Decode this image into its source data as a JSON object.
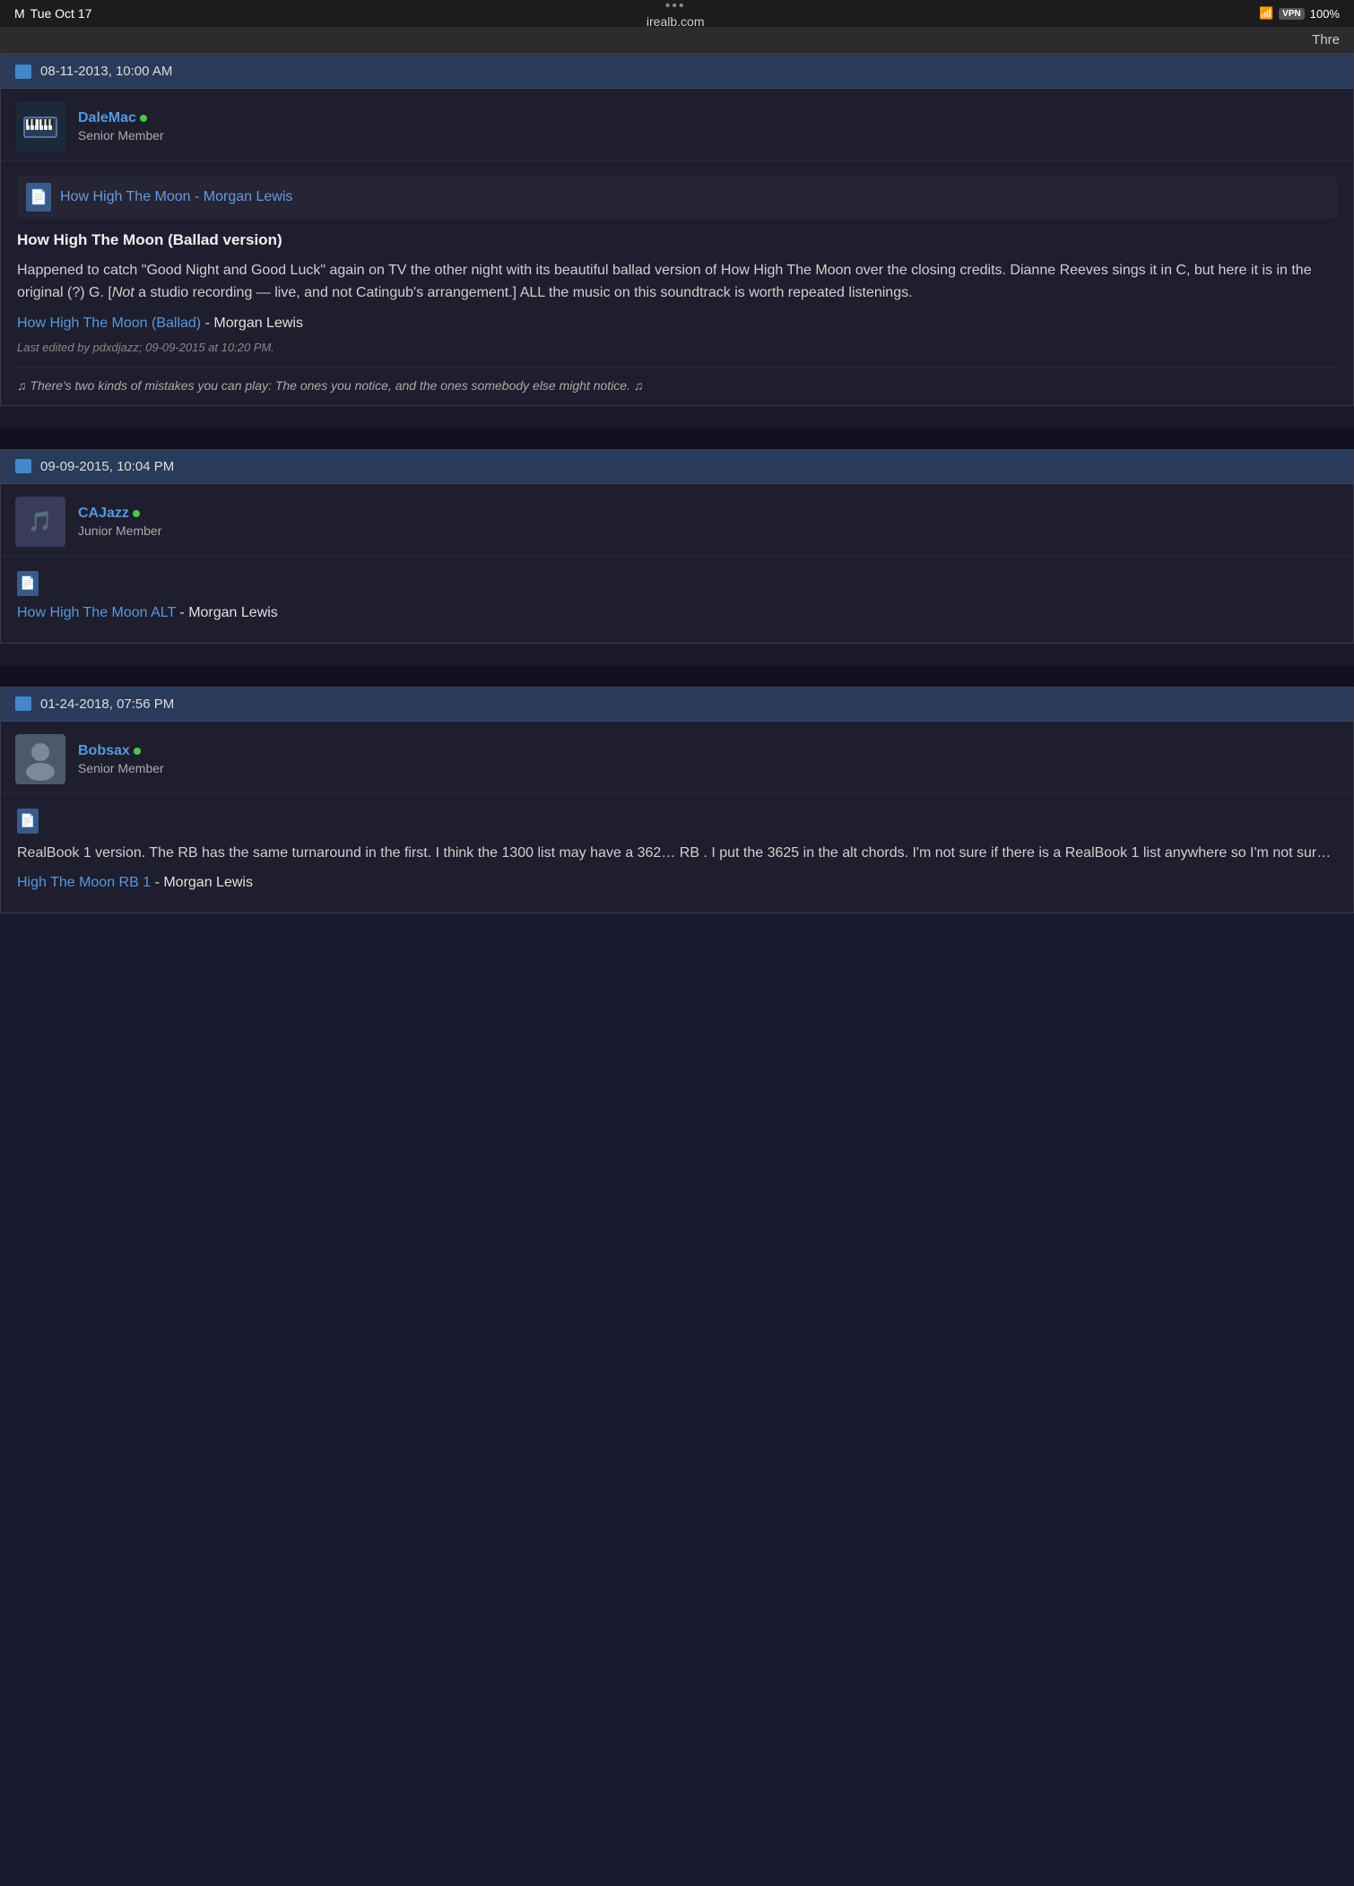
{
  "status_bar": {
    "carrier": "M",
    "datetime": "Tue Oct 17",
    "three_dots": "•••",
    "site": "irealb.com",
    "wifi": "WiFi",
    "vpn": "VPN",
    "battery": "100%"
  },
  "page_top_right": "Thre",
  "posts": [
    {
      "id": "post1",
      "date": "08-11-2013,   10:00 AM",
      "user": {
        "name": "DaleMac",
        "role": "Senior Member",
        "avatar_type": "piano"
      },
      "song_link": {
        "title": "How High The Moon - Morgan Lewis",
        "icon": "📄"
      },
      "title": "How High The Moon (Ballad version)",
      "body_parts": [
        "Happened to catch \"Good Night and Good Luck\" again on TV the other night with its beautiful ballad version of How High The Moon over the closing credits. Dianne Reeves sings it in C, but here it is in the original (?) G. [Not a studio recording — live, and not Catingub's arrangement.] ALL the music on this soundtrack is worth repeated listenings.",
        ""
      ],
      "inline_link": {
        "text": "How High The Moon (Ballad)",
        "suffix": " - Morgan Lewis"
      },
      "edit_notice": "Last edited by pdxdjazz; 09-09-2015 at 10:20 PM.",
      "signature": "♫ There's two kinds of mistakes you can play: The ones you notice, and the ones somebody else might notice. ♫"
    },
    {
      "id": "post2",
      "date": "09-09-2015,   10:04 PM",
      "user": {
        "name": "CAJazz",
        "role": "Junior Member",
        "avatar_type": "music"
      },
      "song_link": null,
      "small_icon": true,
      "inline_link": {
        "text": "How High The Moon ALT",
        "suffix": " - Morgan Lewis"
      },
      "body_parts": [],
      "edit_notice": null,
      "signature": null
    },
    {
      "id": "post3",
      "date": "01-24-2018,   07:56 PM",
      "user": {
        "name": "Bobsax",
        "role": "Senior Member",
        "avatar_type": "default"
      },
      "song_link": null,
      "small_icon": true,
      "body_parts": [
        "RealBook 1 version. The RB has the same turnaround in the first. I think the 1300 list may have a 362… RB . I put the 3625 in the alt chords. I'm not sure if there is a RealBook 1 list anywhere so I'm not sur…"
      ],
      "inline_link": {
        "text": "High The Moon RB 1",
        "suffix": " - Morgan Lewis"
      },
      "edit_notice": null,
      "signature": null
    }
  ],
  "labels": {
    "online_dot": "●",
    "file_icon": "📄"
  }
}
